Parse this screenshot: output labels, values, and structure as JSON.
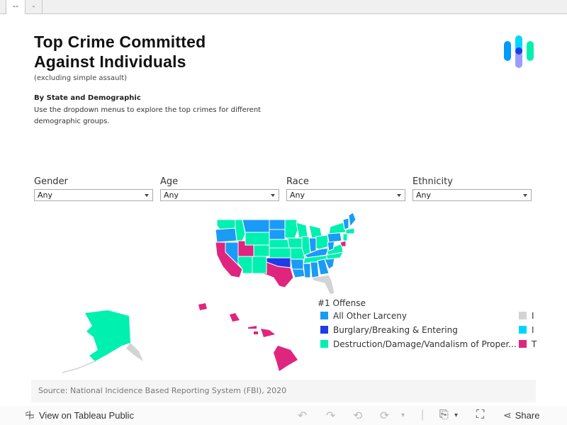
{
  "tabs": [
    {
      "label": "--"
    },
    {
      "label": "-"
    }
  ],
  "header": {
    "title_line1": "Top Crime Committed",
    "title_line2": "Against Individuals",
    "subtitle": "(excluding simple assault)",
    "section_title": "By State and Demographic",
    "description": "Use the dropdown menus to explore the top crimes for different demographic groups."
  },
  "logo": {
    "icon": "tableau-style-logo-icon",
    "colors": [
      "#0099ff",
      "#00d5ff",
      "#1f3de6",
      "#9a9cff",
      "#00f0b0"
    ]
  },
  "filters": [
    {
      "label": "Gender",
      "value": "Any"
    },
    {
      "label": "Age",
      "value": "Any"
    },
    {
      "label": "Race",
      "value": "Any"
    },
    {
      "label": "Ethnicity",
      "value": "Any"
    }
  ],
  "legend": {
    "title": "#1 Offense",
    "items": [
      {
        "label": "All Other Larceny",
        "color": "#1a9bf5"
      },
      {
        "label": "Burglary/Breaking & Entering",
        "color": "#1f3de6"
      },
      {
        "label": "Destruction/Damage/Vandalism of Proper...",
        "color": "#00f0b0"
      },
      {
        "label": "I",
        "color": "#d3d3d3"
      },
      {
        "label": "I",
        "color": "#00d5ff"
      },
      {
        "label": "T",
        "color": "#e0257f"
      }
    ]
  },
  "map": {
    "colors": {
      "larceny": "#1a9bf5",
      "burglary": "#1f3de6",
      "vandalism": "#00f0b0",
      "other": "#d3d3d3",
      "theft": "#e0257f"
    }
  },
  "source": "Source: National Incidence Based Reporting System (FBI), 2020",
  "toolbar": {
    "view_label": "View on Tableau Public",
    "share_label": "Share"
  }
}
